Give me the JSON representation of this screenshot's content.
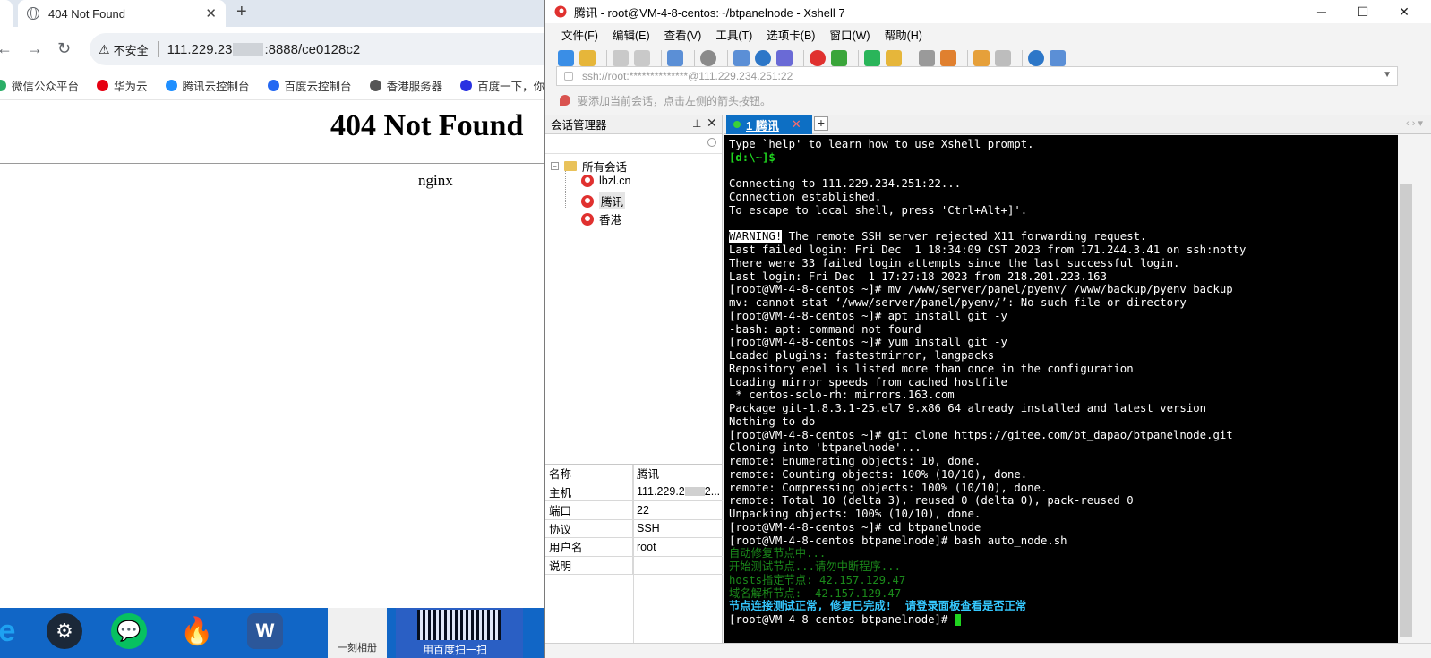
{
  "browser": {
    "tab_title": "404 Not Found",
    "url_insecure": "不安全",
    "url_prefix": "111.229.23",
    "url_suffix": ":8888/ce0128c2",
    "bookmarks": [
      {
        "label": "微信公众平台",
        "color": "#2aae67"
      },
      {
        "label": "华为云",
        "color": "#e60012"
      },
      {
        "label": "腾讯云控制台",
        "color": "#1f8fff"
      },
      {
        "label": "百度云控制台",
        "color": "#2468f2"
      },
      {
        "label": "香港服务器",
        "color": "#555555"
      },
      {
        "label": "百度一下，你就",
        "color": "#2932e1"
      }
    ],
    "heading": "404 Not Found",
    "server": "nginx"
  },
  "taskbar": {
    "album_label": "一刻相册",
    "ad_label": "用百度扫一扫"
  },
  "xshell": {
    "window_title": "腾讯 - root@VM-4-8-centos:~/btpanelnode - Xshell 7",
    "menu": [
      "文件(F)",
      "编辑(E)",
      "查看(V)",
      "工具(T)",
      "选项卡(B)",
      "窗口(W)",
      "帮助(H)"
    ],
    "address": "ssh://root:**************@111.229.234.251:22",
    "hint": "要添加当前会话，点击左侧的箭头按钮。",
    "session_panel_title": "会话管理器",
    "tree_root": "所有会话",
    "sessions": [
      "lbzl.cn",
      "腾讯",
      "香港"
    ],
    "properties": [
      {
        "key": "名称",
        "value": "腾讯"
      },
      {
        "key": "主机",
        "value": "111.229.2"
      },
      {
        "key": "端口",
        "value": "22"
      },
      {
        "key": "协议",
        "value": "SSH"
      },
      {
        "key": "用户名",
        "value": "root"
      },
      {
        "key": "说明",
        "value": ""
      }
    ],
    "host_tail": "2...",
    "tab_label": "1 腾讯",
    "terminal": {
      "lines": [
        {
          "t": "Type `help' to learn how to use Xshell prompt.",
          "s": "normal"
        },
        {
          "t": "[d:\\~]$",
          "s": "green"
        },
        {
          "t": "",
          "s": "normal"
        },
        {
          "t": "Connecting to 111.229.234.251:22...",
          "s": "normal"
        },
        {
          "t": "Connection established.",
          "s": "normal"
        },
        {
          "t": "To escape to local shell, press 'Ctrl+Alt+]'.",
          "s": "normal"
        },
        {
          "t": "",
          "s": "normal"
        },
        {
          "t": "The remote SSH server rejected X11 forwarding request.",
          "s": "warn",
          "badge": "WARNING!"
        },
        {
          "t": "Last failed login: Fri Dec  1 18:34:09 CST 2023 from 171.244.3.41 on ssh:notty",
          "s": "normal"
        },
        {
          "t": "There were 33 failed login attempts since the last successful login.",
          "s": "normal"
        },
        {
          "t": "Last login: Fri Dec  1 17:27:18 2023 from 218.201.223.163",
          "s": "normal"
        },
        {
          "t": "[root@VM-4-8-centos ~]# mv /www/server/panel/pyenv/ /www/backup/pyenv_backup",
          "s": "normal"
        },
        {
          "t": "mv: cannot stat ‘/www/server/panel/pyenv/’: No such file or directory",
          "s": "normal"
        },
        {
          "t": "[root@VM-4-8-centos ~]# apt install git -y",
          "s": "normal"
        },
        {
          "t": "-bash: apt: command not found",
          "s": "normal"
        },
        {
          "t": "[root@VM-4-8-centos ~]# yum install git -y",
          "s": "normal"
        },
        {
          "t": "Loaded plugins: fastestmirror, langpacks",
          "s": "normal"
        },
        {
          "t": "Repository epel is listed more than once in the configuration",
          "s": "normal"
        },
        {
          "t": "Loading mirror speeds from cached hostfile",
          "s": "normal"
        },
        {
          "t": " * centos-sclo-rh: mirrors.163.com",
          "s": "normal"
        },
        {
          "t": "Package git-1.8.3.1-25.el7_9.x86_64 already installed and latest version",
          "s": "normal"
        },
        {
          "t": "Nothing to do",
          "s": "normal"
        },
        {
          "t": "[root@VM-4-8-centos ~]# git clone https://gitee.com/bt_dapao/btpanelnode.git",
          "s": "normal"
        },
        {
          "t": "Cloning into 'btpanelnode'...",
          "s": "normal"
        },
        {
          "t": "remote: Enumerating objects: 10, done.",
          "s": "normal"
        },
        {
          "t": "remote: Counting objects: 100% (10/10), done.",
          "s": "normal"
        },
        {
          "t": "remote: Compressing objects: 100% (10/10), done.",
          "s": "normal"
        },
        {
          "t": "remote: Total 10 (delta 3), reused 0 (delta 0), pack-reused 0",
          "s": "normal"
        },
        {
          "t": "Unpacking objects: 100% (10/10), done.",
          "s": "normal"
        },
        {
          "t": "[root@VM-4-8-centos ~]# cd btpanelnode",
          "s": "normal"
        },
        {
          "t": "[root@VM-4-8-centos btpanelnode]# bash auto_node.sh",
          "s": "normal"
        },
        {
          "t": "自动修复节点中...",
          "s": "dim"
        },
        {
          "t": "开始测试节点...请勿中断程序...",
          "s": "dim"
        },
        {
          "t": "hosts指定节点: 42.157.129.47",
          "s": "dim"
        },
        {
          "t": "域名解析节点:  42.157.129.47",
          "s": "dim"
        },
        {
          "t": "节点连接测试正常, 修复已完成!  请登录面板查看是否正常",
          "s": "cyan"
        },
        {
          "t": "[root@VM-4-8-centos btpanelnode]# ",
          "s": "prompt"
        }
      ]
    }
  }
}
